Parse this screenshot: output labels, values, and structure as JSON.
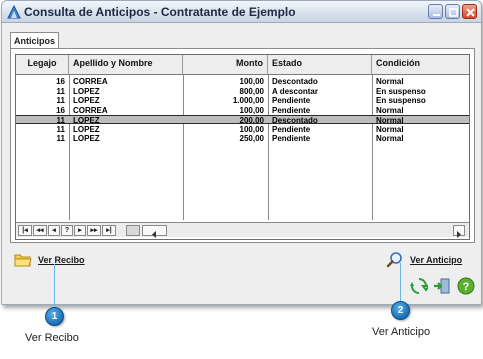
{
  "window": {
    "title": "Consulta de Anticipos - Contratante de Ejemplo"
  },
  "tabs": [
    {
      "label": "Anticipos"
    }
  ],
  "grid": {
    "columns": [
      "Legajo",
      "Apellido y Nombre",
      "Monto",
      "Estado",
      "Condición"
    ],
    "rows": [
      [
        "16",
        "CORREA",
        "100,00",
        "Descontado",
        "Normal"
      ],
      [
        "11",
        "LOPEZ",
        "800,00",
        "A descontar",
        "En suspenso"
      ],
      [
        "11",
        "LOPEZ",
        "1.000,00",
        "Pendiente",
        "En suspenso"
      ],
      [
        "16",
        "CORREA",
        "100,00",
        "Pendiente",
        "Normal"
      ],
      [
        "11",
        "LOPEZ",
        "200,00",
        "Descontado",
        "Normal"
      ],
      [
        "11",
        "LOPEZ",
        "100,00",
        "Pendiente",
        "Normal"
      ],
      [
        "11",
        "LOPEZ",
        "250,00",
        "Pendiente",
        "Normal"
      ]
    ],
    "selected_row": 4,
    "nav": {
      "first": "|◂",
      "prev_page": "◂◂",
      "prev": "◂",
      "help": "?",
      "next": "▸",
      "next_page": "▸▸",
      "last": "▸|"
    }
  },
  "actions": {
    "ver_recibo": "Ver Recibo",
    "ver_anticipo": "Ver Anticipo"
  },
  "callouts": [
    {
      "number": "1",
      "label": "Ver Recibo"
    },
    {
      "number": "2",
      "label": "Ver Anticipo"
    }
  ],
  "icons": {
    "title": "app-icon",
    "ver_recibo": "folder-icon",
    "ver_anticipo": "magnifier-icon",
    "refresh": "refresh-icon",
    "exit": "exit-icon",
    "help": "help-icon"
  },
  "colors": {
    "selected_row": "#bdbdbd",
    "callout_badge": "#176eb5",
    "callout_line": "#6cb8e6",
    "help_icon": "#5cb030"
  }
}
